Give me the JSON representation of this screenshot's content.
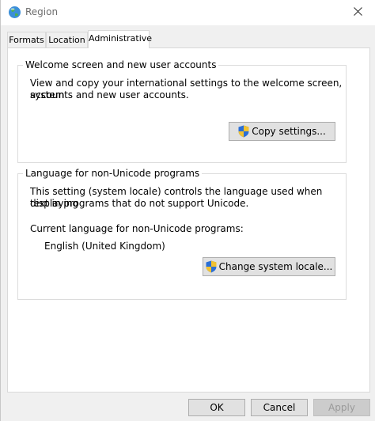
{
  "window": {
    "title": "Region"
  },
  "tabs": [
    {
      "label": "Formats",
      "active": false
    },
    {
      "label": "Location",
      "active": false
    },
    {
      "label": "Administrative",
      "active": true
    }
  ],
  "welcome_section": {
    "title": "Welcome screen and new user accounts",
    "description_line1": "View and copy your international settings to the welcome screen, system",
    "description_line2": "accounts and new user accounts.",
    "copy_button": "Copy settings..."
  },
  "unicode_section": {
    "title": "Language for non-Unicode programs",
    "description_line1": "This setting (system locale) controls the language used when displaying",
    "description_line2": "text in programs that do not support Unicode.",
    "current_label": "Current language for non-Unicode programs:",
    "current_value": "English (United Kingdom)",
    "change_button": "Change system locale..."
  },
  "footer": {
    "ok_label": "OK",
    "cancel_label": "Cancel",
    "apply_label": "Apply"
  },
  "colors": {
    "shield_blue": "#2b6fd6",
    "shield_yellow": "#f2c230",
    "disabled_text": "#9a9a9a"
  }
}
